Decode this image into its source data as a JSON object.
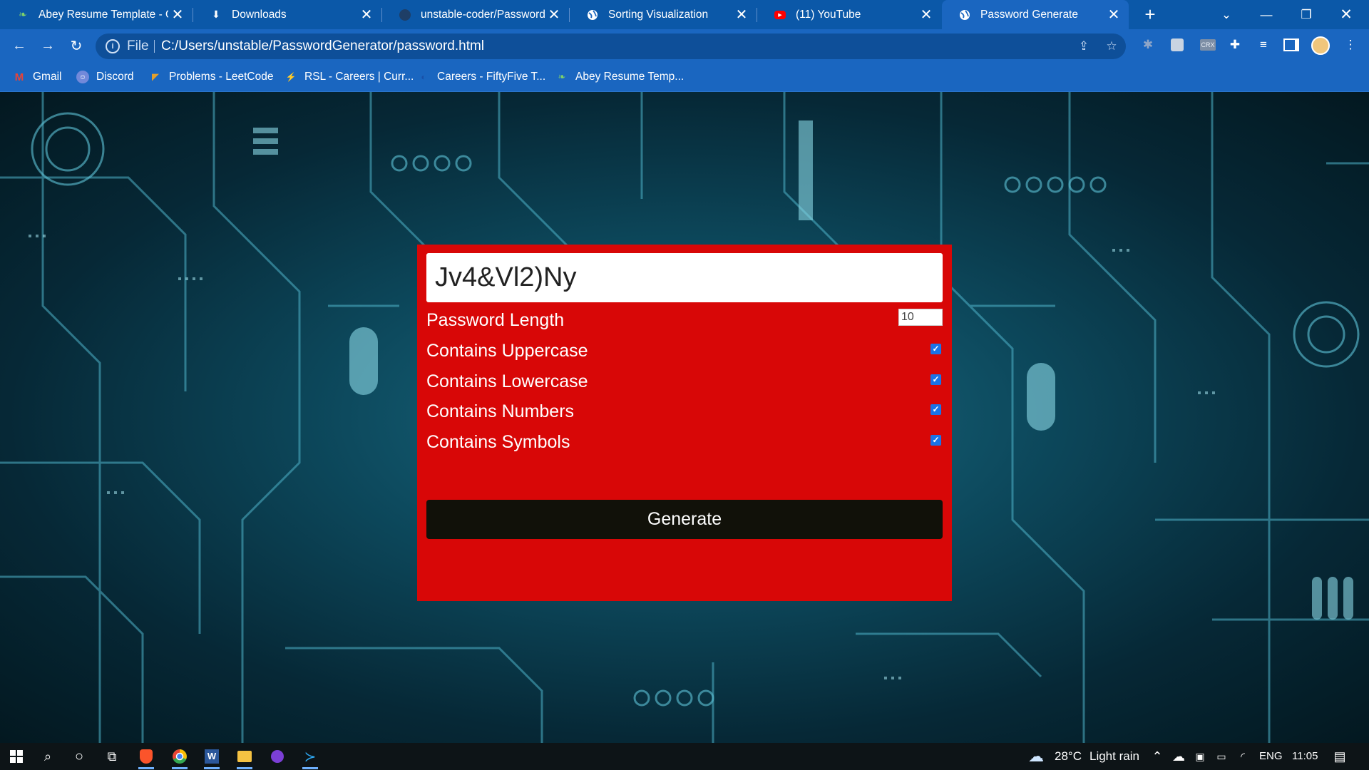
{
  "browser": {
    "tabs": [
      {
        "title": "Abey Resume Template - O",
        "icon": "overleaf-icon",
        "close": "✕"
      },
      {
        "title": "Downloads",
        "icon": "download-icon",
        "close": "✕"
      },
      {
        "title": "unstable-coder/PasswordG",
        "icon": "github-icon",
        "close": "✕"
      },
      {
        "title": "Sorting Visualization",
        "icon": "globe-icon",
        "close": "✕"
      },
      {
        "title": "(11) YouTube",
        "icon": "youtube-icon",
        "close": "✕"
      },
      {
        "title": "Password Generate",
        "icon": "globe-icon",
        "close": "✕"
      }
    ],
    "new_tab": "+",
    "address": {
      "scheme_label": "File",
      "url": "C:/Users/unstable/PasswordGenerator/password.html"
    },
    "bookmarks": [
      {
        "label": "Gmail",
        "icon": "gmail-icon"
      },
      {
        "label": "Discord",
        "icon": "discord-icon"
      },
      {
        "label": "Problems - LeetCode",
        "icon": "leetcode-icon"
      },
      {
        "label": "RSL - Careers | Curr...",
        "icon": "rsl-icon"
      },
      {
        "label": "Careers - FiftyFive T...",
        "icon": "fiftyfive-icon"
      },
      {
        "label": "Abey Resume Temp...",
        "icon": "overleaf-icon"
      }
    ]
  },
  "app": {
    "password": "Jv4&Vl2)Ny",
    "length_label": "Password Length",
    "length_value": "10",
    "options": [
      {
        "label": "Contains Uppercase",
        "checked": true
      },
      {
        "label": "Contains Lowercase",
        "checked": true
      },
      {
        "label": "Contains Numbers",
        "checked": true
      },
      {
        "label": "Contains Symbols",
        "checked": true
      }
    ],
    "generate_label": "Generate",
    "colors": {
      "card": "#d80707",
      "button": "#111109",
      "checkbox": "#1a73e8"
    }
  },
  "taskbar": {
    "weather_temp": "28°C",
    "weather_desc": "Light rain",
    "language": "ENG",
    "time": "11:05"
  }
}
